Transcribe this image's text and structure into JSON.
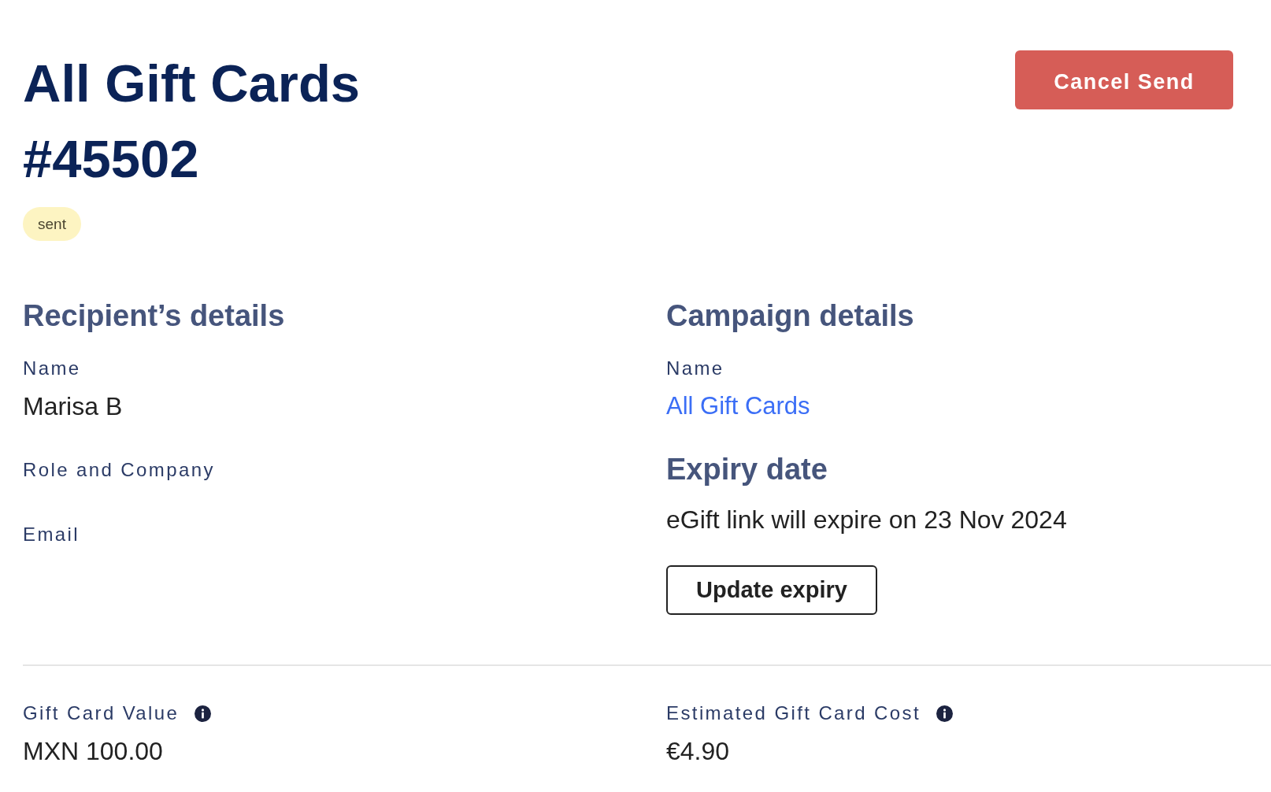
{
  "header": {
    "title": "All Gift Cards #45502",
    "status_badge": "sent",
    "cancel_button": "Cancel Send"
  },
  "sections": [
    {
      "heading": "Recipient’s details",
      "items": [
        {
          "kind": "field",
          "label": "Name",
          "value": "Marisa B"
        },
        {
          "kind": "field",
          "label": "Role and Company"
        },
        {
          "kind": "field",
          "label": "Email"
        }
      ]
    },
    {
      "heading": "Campaign details",
      "items": [
        {
          "kind": "link_field",
          "label": "Name",
          "value": "All Gift Cards"
        },
        {
          "kind": "heading",
          "text": "Expiry date"
        },
        {
          "kind": "text",
          "text": "eGift link will expire on 23 Nov 2024"
        },
        {
          "kind": "button",
          "label": "Update expiry"
        }
      ]
    }
  ],
  "summary": [
    {
      "label": "Gift Card Value",
      "info": true,
      "value": "MXN 100.00"
    },
    {
      "label": "Estimated Gift Card Cost",
      "info": true,
      "value": "€4.90"
    }
  ]
}
